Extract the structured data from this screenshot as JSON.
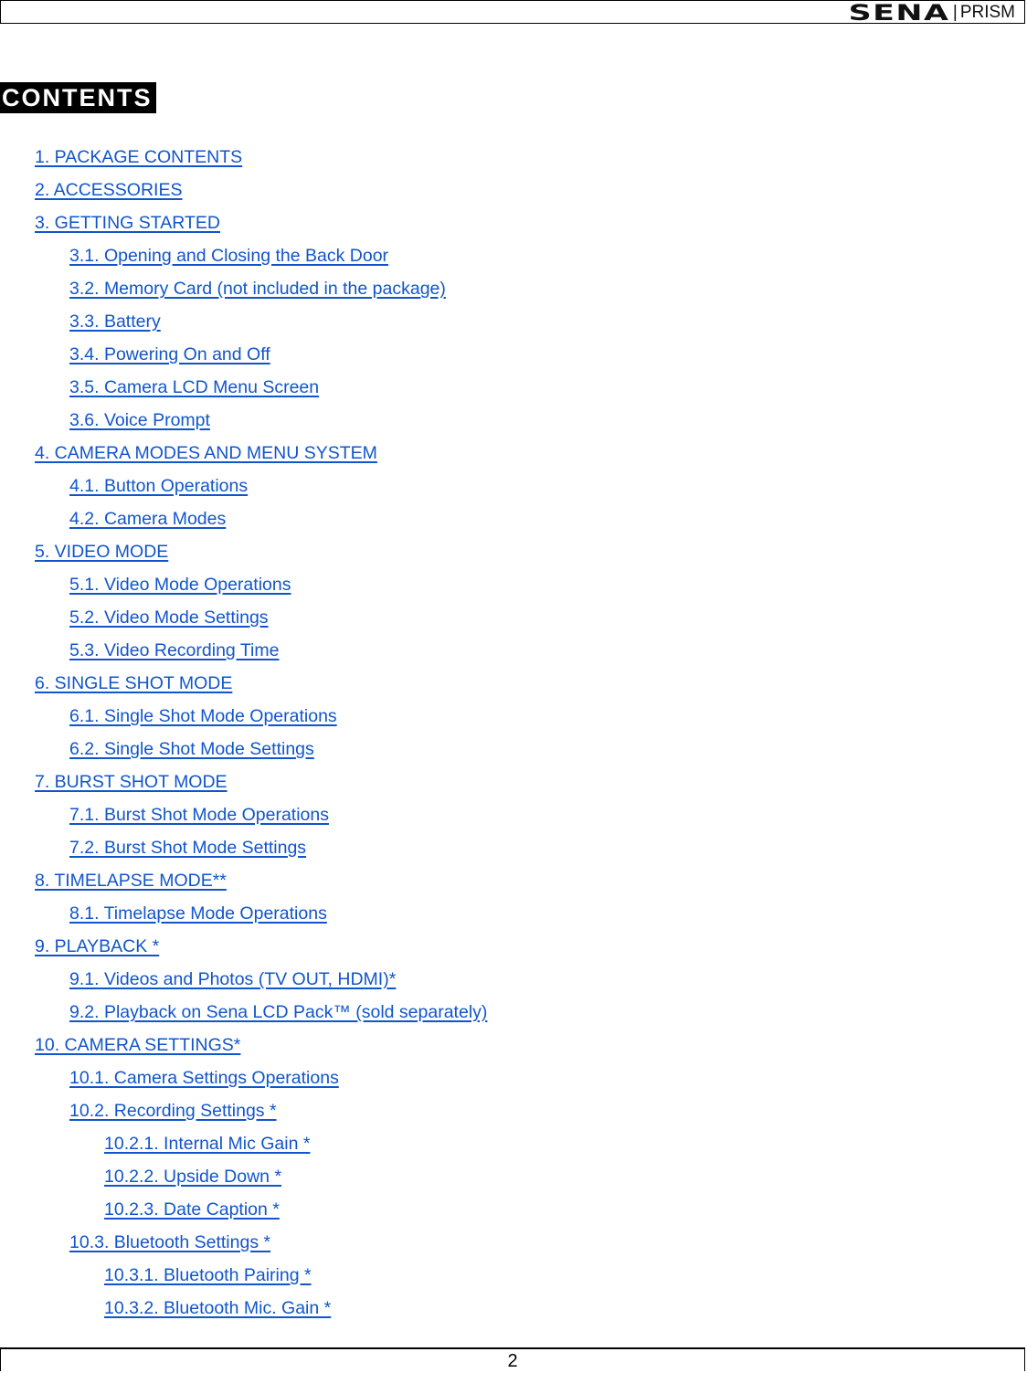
{
  "header": {
    "brand": "SENA",
    "separator": "|",
    "product": "PRISM"
  },
  "title": "CONTENTS",
  "toc": [
    {
      "level": 1,
      "label": "1. PACKAGE CONTENTS"
    },
    {
      "level": 1,
      "label": "2. ACCESSORIES"
    },
    {
      "level": 1,
      "label": "3. GETTING STARTED"
    },
    {
      "level": 2,
      "label": "3.1. Opening and Closing the Back Door"
    },
    {
      "level": 2,
      "label": "3.2. Memory Card (not included in the package)"
    },
    {
      "level": 2,
      "label": "3.3. Battery"
    },
    {
      "level": 2,
      "label": "3.4. Powering On and Off"
    },
    {
      "level": 2,
      "label": "3.5. Camera LCD Menu Screen"
    },
    {
      "level": 2,
      "label": "3.6. Voice Prompt"
    },
    {
      "level": 1,
      "label": "4. CAMERA MODES AND MENU SYSTEM"
    },
    {
      "level": 2,
      "label": "4.1. Button Operations"
    },
    {
      "level": 2,
      "label": "4.2. Camera Modes"
    },
    {
      "level": 1,
      "label": "5. VIDEO MODE"
    },
    {
      "level": 2,
      "label": "5.1. Video Mode Operations"
    },
    {
      "level": 2,
      "label": "5.2. Video Mode Settings"
    },
    {
      "level": 2,
      "label": "5.3. Video Recording Time"
    },
    {
      "level": 1,
      "label": "6. SINGLE SHOT MODE"
    },
    {
      "level": 2,
      "label": "6.1. Single Shot Mode Operations"
    },
    {
      "level": 2,
      "label": "6.2. Single Shot Mode Settings"
    },
    {
      "level": 1,
      "label": "7. BURST SHOT MODE"
    },
    {
      "level": 2,
      "label": "7.1. Burst Shot Mode Operations"
    },
    {
      "level": 2,
      "label": "7.2. Burst Shot Mode Settings"
    },
    {
      "level": 1,
      "label": "8. TIMELAPSE MODE**"
    },
    {
      "level": 2,
      "label": "8.1. Timelapse Mode Operations"
    },
    {
      "level": 1,
      "label": "9. PLAYBACK *"
    },
    {
      "level": 2,
      "label": "9.1. Videos and Photos (TV OUT, HDMI)*"
    },
    {
      "level": 2,
      "label": "9.2. Playback on Sena LCD Pack™ (sold separately)"
    },
    {
      "level": 1,
      "label": "10. CAMERA SETTINGS*"
    },
    {
      "level": 2,
      "label": "10.1. Camera Settings Operations"
    },
    {
      "level": 2,
      "label": "10.2. Recording Settings *"
    },
    {
      "level": 3,
      "label": "10.2.1. Internal Mic Gain *"
    },
    {
      "level": 3,
      "label": "10.2.2. Upside Down *"
    },
    {
      "level": 3,
      "label": "10.2.3. Date Caption *"
    },
    {
      "level": 2,
      "label": "10.3. Bluetooth Settings *"
    },
    {
      "level": 3,
      "label": "10.3.1. Bluetooth Pairing *"
    },
    {
      "level": 3,
      "label": "10.3.2. Bluetooth Mic. Gain *"
    }
  ],
  "footer": {
    "page_number": "2"
  },
  "colors": {
    "link": "#1155cc",
    "title_bg": "#000000",
    "title_fg": "#ffffff"
  }
}
